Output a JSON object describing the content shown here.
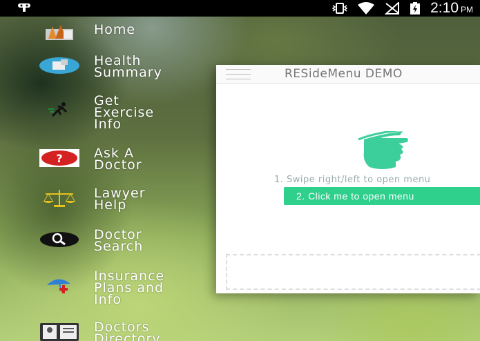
{
  "status_bar": {
    "time": "2:10",
    "ampm": "PM",
    "left_icon": "bug-icon",
    "icons": [
      "vibrate-icon",
      "wifi-icon",
      "no-signal-icon",
      "battery-charging-icon"
    ]
  },
  "menu": {
    "items": [
      {
        "label": "Home",
        "icon": "home-icon"
      },
      {
        "label": "Health\nSummary",
        "icon": "health-summary-icon"
      },
      {
        "label": "Get\nExercise\nInfo",
        "icon": "runner-icon"
      },
      {
        "label": "Ask A\nDoctor",
        "icon": "question-icon"
      },
      {
        "label": "Lawyer\nHelp",
        "icon": "scales-icon"
      },
      {
        "label": "Doctor\nSearch",
        "icon": "magnifier-icon"
      },
      {
        "label": "Insurance\nPlans and\nInfo",
        "icon": "umbrella-icon"
      },
      {
        "label": "Doctors\nDirectory",
        "icon": "directory-icon"
      }
    ]
  },
  "content": {
    "title": "RESideMenu DEMO",
    "swipe_hint": "1. Swipe right/left to open menu",
    "open_button_label": "2. Click me to open menu",
    "accent_color": "#2fcf8c"
  }
}
